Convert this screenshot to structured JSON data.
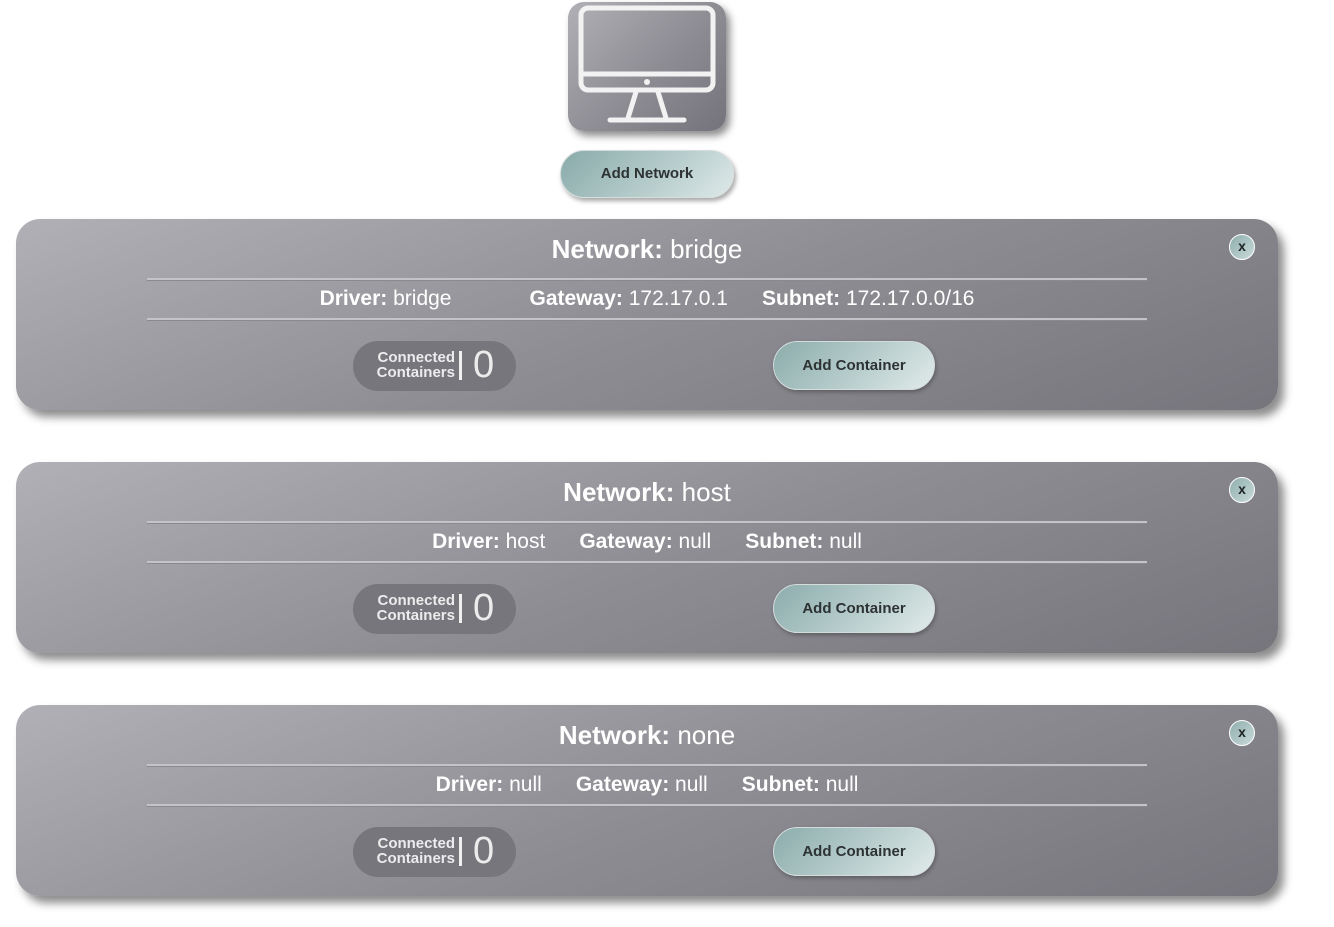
{
  "host": {
    "icon": "monitor-icon",
    "add_network_label": "Add Network"
  },
  "labels": {
    "network_key": "Network:",
    "driver_key": "Driver:",
    "gateway_key": "Gateway:",
    "subnet_key": "Subnet:",
    "connected_line1": "Connected",
    "connected_line2": "Containers",
    "add_container_label": "Add Container",
    "close_label": "x"
  },
  "networks": [
    {
      "name": "bridge",
      "driver": "bridge",
      "gateway": "172.17.0.1",
      "subnet": "172.17.0.0/16",
      "connected_containers": "0"
    },
    {
      "name": "host",
      "driver": "host",
      "gateway": "null",
      "subnet": "null",
      "connected_containers": "0"
    },
    {
      "name": "none",
      "driver": "null",
      "gateway": "null",
      "subnet": "null",
      "connected_containers": "0"
    }
  ],
  "colors": {
    "card": "#8f8e94",
    "button_accent": "#b9cfce",
    "text": "#ffffff"
  }
}
